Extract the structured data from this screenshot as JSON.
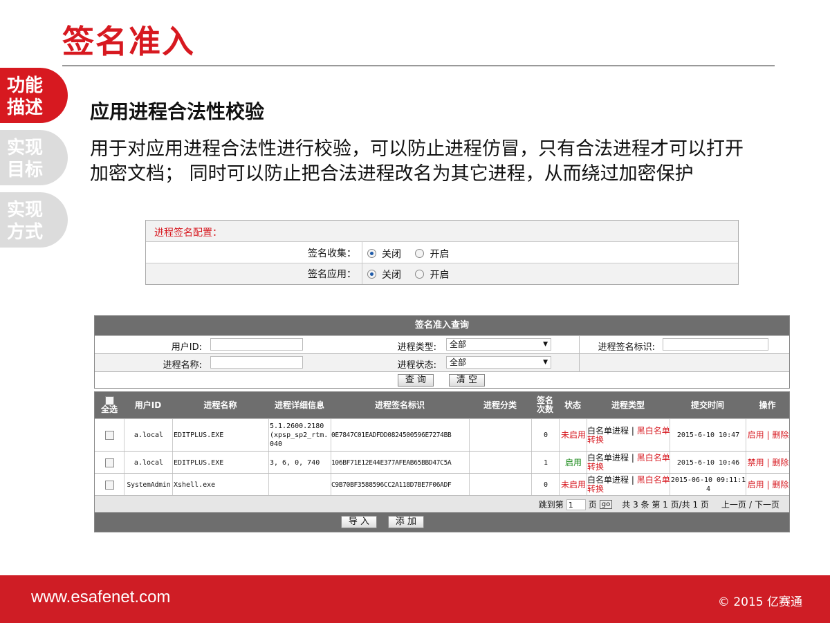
{
  "title": "签名准入",
  "sidebar": {
    "tabs": [
      {
        "line1": "功能",
        "line2": "描述"
      },
      {
        "line1": "实现",
        "line2": "目标"
      },
      {
        "line1": "实现",
        "line2": "方式"
      }
    ]
  },
  "heading": "应用进程合法性校验",
  "description": {
    "line1": "用于对应用进程合法性进行校验，可以防止进程仿冒，只有合法进程才可以打开",
    "line2": "加密文档；  同时可以防止把合法进程改名为其它进程，从而绕过加密保护"
  },
  "config": {
    "title": "进程签名配置：",
    "rows": [
      {
        "label": "签名收集：",
        "opt_off": "关闭",
        "opt_on": "开启"
      },
      {
        "label": "签名应用：",
        "opt_off": "关闭",
        "opt_on": "开启"
      }
    ]
  },
  "query": {
    "title": "签名准入查询",
    "user_id_label": "用户ID:",
    "process_name_label": "进程名称:",
    "process_type_label": "进程类型:",
    "process_type_value": "全部",
    "process_status_label": "进程状态:",
    "process_status_value": "全部",
    "signature_label": "进程签名标识:",
    "search_button": "查 询",
    "clear_button": "清 空"
  },
  "grid": {
    "headers": {
      "select_all": "全选",
      "user_id": "用户ID",
      "process_name": "进程名称",
      "process_detail": "进程详细信息",
      "signature": "进程签名标识",
      "category": "进程分类",
      "sign_count": "签名次数",
      "status": "状态",
      "process_type": "进程类型",
      "submit_time": "提交时间",
      "action": "操作"
    },
    "rows": [
      {
        "user": "a.local",
        "name": "EDITPLUS.EXE",
        "detail": "5.1.2600.2180(xpsp_sp2_rtm.040",
        "signature": "0E7847C01EADFDD0824500596E7274BB",
        "count": "0",
        "status": "未启用",
        "type_a": "白名单进程",
        "type_b": "黑白名单转换",
        "time": "2015-6-10 10:47",
        "act_a": "启用",
        "act_b": "删除"
      },
      {
        "user": "a.local",
        "name": "EDITPLUS.EXE",
        "detail": "3, 6, 0, 740",
        "signature": "106BF71E12E44E377AFEAB65BBD47C5A",
        "count": "1",
        "status": "启用",
        "type_a": "白名单进程",
        "type_b": "黑白名单转换",
        "time": "2015-6-10 10:46",
        "act_a": "禁用",
        "act_b": "删除"
      },
      {
        "user": "SystemAdmin",
        "name": "Xshell.exe",
        "detail": "",
        "signature": "C9B70BF3588596CC2A118D7BE7F06ADF",
        "count": "0",
        "status": "未启用",
        "type_a": "白名单进程",
        "type_b": "黑白名单转换",
        "time": "2015-06-10 09:11:14",
        "act_a": "启用",
        "act_b": "删除"
      }
    ],
    "pager": {
      "jump_label": "跳到第",
      "page_value": "1",
      "page_unit": "页",
      "go": "go",
      "summary": "共 3 条  第 1 页/共 1 页",
      "prev": "上一页",
      "sep": "/",
      "next": "下一页"
    },
    "import_button": "导 入",
    "add_button": "添 加"
  },
  "footer": {
    "url": "www.esafenet.com",
    "copyright": "© 2015 亿赛通"
  },
  "colors": {
    "brand_red": "#d71920",
    "header_gray": "#6e6e6e",
    "tab_inactive": "#dcdcdc"
  }
}
